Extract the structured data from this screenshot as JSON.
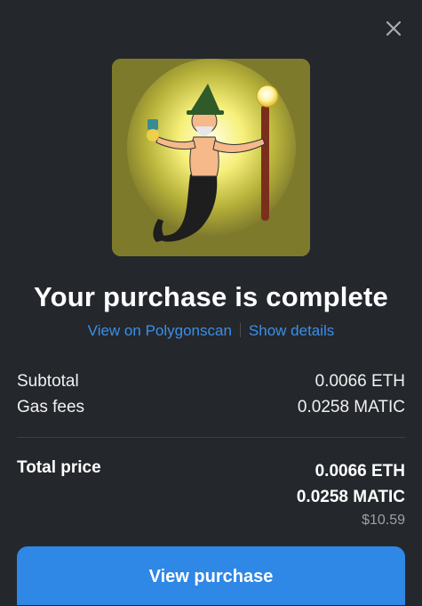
{
  "dialog": {
    "close_icon": "close-icon",
    "title": "Your purchase is complete",
    "links": {
      "view_on_explorer": "View on Polygonscan",
      "show_details": "Show details"
    },
    "summary": {
      "subtotal_label": "Subtotal",
      "subtotal_value": "0.0066 ETH",
      "gas_label": "Gas fees",
      "gas_value": "0.0258 MATIC"
    },
    "total": {
      "label": "Total price",
      "eth_value": "0.0066 ETH",
      "matic_value": "0.0258 MATIC",
      "usd_value": "$10.59"
    },
    "primary_button": "View purchase"
  },
  "colors": {
    "background": "#24272c",
    "accent": "#2f87e6",
    "link": "#3b8fe8",
    "muted": "#9aa0a8",
    "nft_background": "#7e7a2c"
  }
}
